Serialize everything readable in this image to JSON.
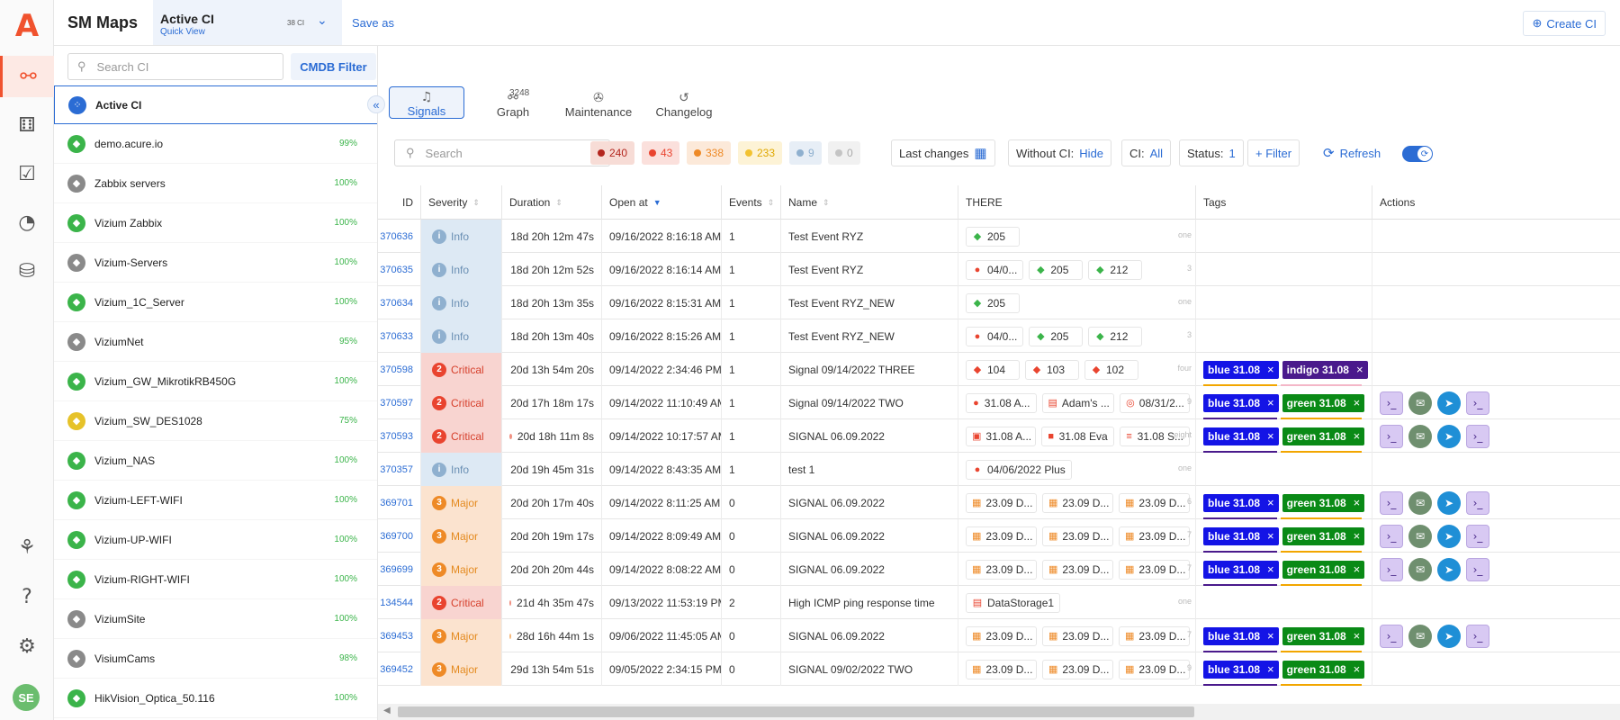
{
  "app": {
    "title": "SM Maps",
    "logo_letter": "A"
  },
  "header": {
    "view_name": "Active CI",
    "view_sub": "Quick View",
    "view_count": "38 CI",
    "save_as": "Save as",
    "create_ci": "Create CI"
  },
  "rail": {
    "avatar": "SE",
    "icons": [
      "sm-maps-icon",
      "dashboard-icon",
      "checklist-icon",
      "pie-chart-icon",
      "cmdb-icon",
      "topology-icon",
      "help-icon",
      "settings-icon"
    ]
  },
  "sidebar": {
    "search_placeholder": "Search CI",
    "cmdb_filter": "CMDB Filter",
    "items": [
      {
        "name": "Active CI",
        "pct": "",
        "color": "#2b6cd4",
        "selected": true
      },
      {
        "name": "demo.acure.io",
        "pct": "99%",
        "color": "#3bb44a"
      },
      {
        "name": "Zabbix servers",
        "pct": "100%",
        "color": "#8a8a8a"
      },
      {
        "name": "Vizium Zabbix",
        "pct": "100%",
        "color": "#3bb44a"
      },
      {
        "name": "Vizium-Servers",
        "pct": "100%",
        "color": "#8a8a8a"
      },
      {
        "name": "Vizium_1C_Server",
        "pct": "100%",
        "color": "#3bb44a"
      },
      {
        "name": "ViziumNet",
        "pct": "95%",
        "color": "#8a8a8a"
      },
      {
        "name": "Vizium_GW_MikrotikRB450G",
        "pct": "100%",
        "color": "#3bb44a"
      },
      {
        "name": "Vizium_SW_DES1028",
        "pct": "75%",
        "color": "#e6c229"
      },
      {
        "name": "Vizium_NAS",
        "pct": "100%",
        "color": "#3bb44a"
      },
      {
        "name": "Vizium-LEFT-WIFI",
        "pct": "100%",
        "color": "#3bb44a"
      },
      {
        "name": "Vizium-UP-WIFI",
        "pct": "100%",
        "color": "#3bb44a"
      },
      {
        "name": "Vizium-RIGHT-WIFI",
        "pct": "100%",
        "color": "#3bb44a"
      },
      {
        "name": "ViziumSite",
        "pct": "100%",
        "color": "#8a8a8a"
      },
      {
        "name": "VisiumCams",
        "pct": "98%",
        "color": "#8a8a8a"
      },
      {
        "name": "HikVision_Optica_50.116",
        "pct": "100%",
        "color": "#3bb44a"
      }
    ]
  },
  "tabs": [
    {
      "label": "Signals",
      "count": ""
    },
    {
      "label": "Graph",
      "count": "3248"
    },
    {
      "label": "Maintenance",
      "count": ""
    },
    {
      "label": "Changelog",
      "count": ""
    }
  ],
  "filters": {
    "search_placeholder": "Search",
    "sev_counts": [
      {
        "value": "240",
        "bg": "#f7dcd6",
        "dot": "#b3261e",
        "color": "#b3261e"
      },
      {
        "value": "43",
        "bg": "#fbe0dc",
        "dot": "#e9442f",
        "color": "#e9442f"
      },
      {
        "value": "338",
        "bg": "#fce9d9",
        "dot": "#ee8a27",
        "color": "#ee8a27"
      },
      {
        "value": "233",
        "bg": "#fdf3d6",
        "dot": "#f2c230",
        "color": "#e0a800"
      },
      {
        "value": "9",
        "bg": "#e7eef6",
        "dot": "#8fb0cf",
        "color": "#8fb0cf"
      },
      {
        "value": "0",
        "bg": "#f1f1f1",
        "dot": "#c4c4c4",
        "color": "#aaa"
      }
    ],
    "last_changes": "Last changes",
    "without_ci_label": "Without CI:",
    "without_ci_value": "Hide",
    "ci_label": "CI:",
    "ci_value": "All",
    "status_label": "Status:",
    "status_value": "1",
    "add_filter": "+ Filter",
    "refresh": "Refresh"
  },
  "columns": [
    "ID",
    "Severity",
    "Duration",
    "Open at",
    "Events",
    "Name",
    "THERE",
    "Tags",
    "Actions"
  ],
  "rows": [
    {
      "id": "370636",
      "sev": "info",
      "sev_label": "Info",
      "sev_num": "i",
      "dur": "18d 20h 12m 47s",
      "open": "09/16/2022 8:16:18 AM",
      "events": "1",
      "name": "Test Event RYZ",
      "there": [
        {
          "ic": "◆",
          "c": "#3bb44a",
          "t": "205"
        }
      ],
      "extra": "one",
      "tags": [],
      "actions": false
    },
    {
      "id": "370635",
      "sev": "info",
      "sev_label": "Info",
      "sev_num": "i",
      "dur": "18d 20h 12m 52s",
      "open": "09/16/2022 8:16:14 AM",
      "events": "1",
      "name": "Test Event RYZ",
      "there": [
        {
          "ic": "●",
          "c": "#e9442f",
          "t": "04/0..."
        },
        {
          "ic": "◆",
          "c": "#3bb44a",
          "t": "205"
        },
        {
          "ic": "◆",
          "c": "#3bb44a",
          "t": "212"
        }
      ],
      "extra": "3",
      "tags": [],
      "actions": false
    },
    {
      "id": "370634",
      "sev": "info",
      "sev_label": "Info",
      "sev_num": "i",
      "dur": "18d 20h 13m 35s",
      "open": "09/16/2022 8:15:31 AM",
      "events": "1",
      "name": "Test Event RYZ_NEW",
      "there": [
        {
          "ic": "◆",
          "c": "#3bb44a",
          "t": "205"
        }
      ],
      "extra": "one",
      "tags": [],
      "actions": false
    },
    {
      "id": "370633",
      "sev": "info",
      "sev_label": "Info",
      "sev_num": "i",
      "dur": "18d 20h 13m 40s",
      "open": "09/16/2022 8:15:26 AM",
      "events": "1",
      "name": "Test Event RYZ_NEW",
      "there": [
        {
          "ic": "●",
          "c": "#e9442f",
          "t": "04/0..."
        },
        {
          "ic": "◆",
          "c": "#3bb44a",
          "t": "205"
        },
        {
          "ic": "◆",
          "c": "#3bb44a",
          "t": "212"
        }
      ],
      "extra": "3",
      "tags": [],
      "actions": false
    },
    {
      "id": "370598",
      "sev": "critical",
      "sev_label": "Critical",
      "sev_num": "2",
      "dur": "20d 13h 54m 20s",
      "open": "09/14/2022 2:34:46 PM",
      "events": "1",
      "name": "Signal 09/14/2022 THREE",
      "there": [
        {
          "ic": "◆",
          "c": "#e9442f",
          "t": "104"
        },
        {
          "ic": "◆",
          "c": "#e9442f",
          "t": "103"
        },
        {
          "ic": "◆",
          "c": "#e9442f",
          "t": "102"
        }
      ],
      "extra": "four",
      "tags": [
        {
          "t": "blue 31.08",
          "c": "tag-blue"
        },
        {
          "t": "indigo 31.08",
          "c": "tag-indigo"
        }
      ],
      "under": [
        "#f2a600",
        "#f4b7c8"
      ],
      "actions": false
    },
    {
      "id": "370597",
      "sev": "critical",
      "sev_label": "Critical",
      "sev_num": "2",
      "dur": "20d 17h 18m 17s",
      "open": "09/14/2022 11:10:49 AM",
      "events": "1",
      "name": "Signal 09/14/2022 TWO",
      "there": [
        {
          "ic": "●",
          "c": "#e9442f",
          "t": "31.08 A..."
        },
        {
          "ic": "▤",
          "c": "#e9442f",
          "t": "Adam's ..."
        },
        {
          "ic": "◎",
          "c": "#e9442f",
          "t": "08/31/2..."
        }
      ],
      "extra": "9",
      "tags": [
        {
          "t": "blue 31.08",
          "c": "tag-blue"
        },
        {
          "t": "green 31.08",
          "c": "tag-green"
        }
      ],
      "under": [
        "#4a1a8c",
        "#f2a600"
      ],
      "actions": true
    },
    {
      "id": "370593",
      "sev": "critical",
      "sev_label": "Critical",
      "sev_num": "2",
      "dur": "20d 18h 11m 8s",
      "open": "09/14/2022 10:17:57 AM",
      "events": "1",
      "name": "SIGNAL 06.09.2022",
      "there": [
        {
          "ic": "▣",
          "c": "#e9442f",
          "t": "31.08 A..."
        },
        {
          "ic": "■",
          "c": "#e9442f",
          "t": "31.08 Eva"
        },
        {
          "ic": "≡",
          "c": "#e9442f",
          "t": "31.08 S..."
        }
      ],
      "extra": "eight",
      "tags": [
        {
          "t": "blue 31.08",
          "c": "tag-blue"
        },
        {
          "t": "green 31.08",
          "c": "tag-green"
        }
      ],
      "under": [
        "#4a1a8c",
        "#f2a600"
      ],
      "actions": true
    },
    {
      "id": "370357",
      "sev": "info",
      "sev_label": "Info",
      "sev_num": "i",
      "dur": "20d 19h 45m 31s",
      "open": "09/14/2022 8:43:35 AM",
      "events": "1",
      "name": "test 1",
      "there": [
        {
          "ic": "●",
          "c": "#e9442f",
          "t": "04/06/2022 Plus"
        }
      ],
      "extra": "one",
      "tags": [],
      "actions": false
    },
    {
      "id": "369701",
      "sev": "major",
      "sev_label": "Major",
      "sev_num": "3",
      "dur": "20d 20h 17m 40s",
      "open": "09/14/2022 8:11:25 AM",
      "events": "0",
      "name": "SIGNAL 06.09.2022",
      "there": [
        {
          "ic": "▦",
          "c": "#ee8a27",
          "t": "23.09 D..."
        },
        {
          "ic": "▦",
          "c": "#ee8a27",
          "t": "23.09 D..."
        },
        {
          "ic": "▦",
          "c": "#ee8a27",
          "t": "23.09 D..."
        }
      ],
      "extra": "6",
      "tags": [
        {
          "t": "blue 31.08",
          "c": "tag-blue"
        },
        {
          "t": "green 31.08",
          "c": "tag-green"
        }
      ],
      "under": [
        "#4a1a8c",
        "#f2a600"
      ],
      "actions": true
    },
    {
      "id": "369700",
      "sev": "major",
      "sev_label": "Major",
      "sev_num": "3",
      "dur": "20d 20h 19m 17s",
      "open": "09/14/2022 8:09:49 AM",
      "events": "0",
      "name": "SIGNAL 06.09.2022",
      "there": [
        {
          "ic": "▦",
          "c": "#ee8a27",
          "t": "23.09 D..."
        },
        {
          "ic": "▦",
          "c": "#ee8a27",
          "t": "23.09 D..."
        },
        {
          "ic": "▦",
          "c": "#ee8a27",
          "t": "23.09 D..."
        }
      ],
      "extra": "7",
      "tags": [
        {
          "t": "blue 31.08",
          "c": "tag-blue"
        },
        {
          "t": "green 31.08",
          "c": "tag-green"
        }
      ],
      "under": [
        "#4a1a8c",
        "#f2a600"
      ],
      "actions": true
    },
    {
      "id": "369699",
      "sev": "major",
      "sev_label": "Major",
      "sev_num": "3",
      "dur": "20d 20h 20m 44s",
      "open": "09/14/2022 8:08:22 AM",
      "events": "0",
      "name": "SIGNAL 06.09.2022",
      "there": [
        {
          "ic": "▦",
          "c": "#ee8a27",
          "t": "23.09 D..."
        },
        {
          "ic": "▦",
          "c": "#ee8a27",
          "t": "23.09 D..."
        },
        {
          "ic": "▦",
          "c": "#ee8a27",
          "t": "23.09 D..."
        }
      ],
      "extra": "7",
      "tags": [
        {
          "t": "blue 31.08",
          "c": "tag-blue"
        },
        {
          "t": "green 31.08",
          "c": "tag-green"
        }
      ],
      "under": [
        "#4a1a8c",
        "#f2a600"
      ],
      "actions": true
    },
    {
      "id": "134544",
      "sev": "critical",
      "sev_label": "Critical",
      "sev_num": "2",
      "dur": "21d 4h 35m 47s",
      "open": "09/13/2022 11:53:19 PM",
      "events": "2",
      "name": "High ICMP ping response time",
      "there": [
        {
          "ic": "▤",
          "c": "#e9442f",
          "t": "DataStorage1"
        }
      ],
      "extra": "one",
      "tags": [],
      "actions": false
    },
    {
      "id": "369453",
      "sev": "major",
      "sev_label": "Major",
      "sev_num": "3",
      "dur": "28d 16h 44m 1s",
      "open": "09/06/2022 11:45:05 AM",
      "events": "0",
      "name": "SIGNAL 06.09.2022",
      "there": [
        {
          "ic": "▦",
          "c": "#ee8a27",
          "t": "23.09 D..."
        },
        {
          "ic": "▦",
          "c": "#ee8a27",
          "t": "23.09 D..."
        },
        {
          "ic": "▦",
          "c": "#ee8a27",
          "t": "23.09 D..."
        }
      ],
      "extra": "7",
      "tags": [
        {
          "t": "blue 31.08",
          "c": "tag-blue"
        },
        {
          "t": "green 31.08",
          "c": "tag-green"
        }
      ],
      "under": [
        "#4a1a8c",
        "#f2a600"
      ],
      "actions": true
    },
    {
      "id": "369452",
      "sev": "major",
      "sev_label": "Major",
      "sev_num": "3",
      "dur": "29d 13h 54m 51s",
      "open": "09/05/2022 2:34:15 PM",
      "events": "0",
      "name": "SIGNAL 09/02/2022 TWO",
      "there": [
        {
          "ic": "▦",
          "c": "#ee8a27",
          "t": "23.09 D..."
        },
        {
          "ic": "▦",
          "c": "#ee8a27",
          "t": "23.09 D..."
        },
        {
          "ic": "▦",
          "c": "#ee8a27",
          "t": "23.09 D..."
        }
      ],
      "extra": "9",
      "tags": [
        {
          "t": "blue 31.08",
          "c": "tag-blue"
        },
        {
          "t": "green 31.08",
          "c": "tag-green"
        }
      ],
      "under": [
        "#4a1a8c",
        "#f2a600"
      ],
      "actions": false
    }
  ]
}
